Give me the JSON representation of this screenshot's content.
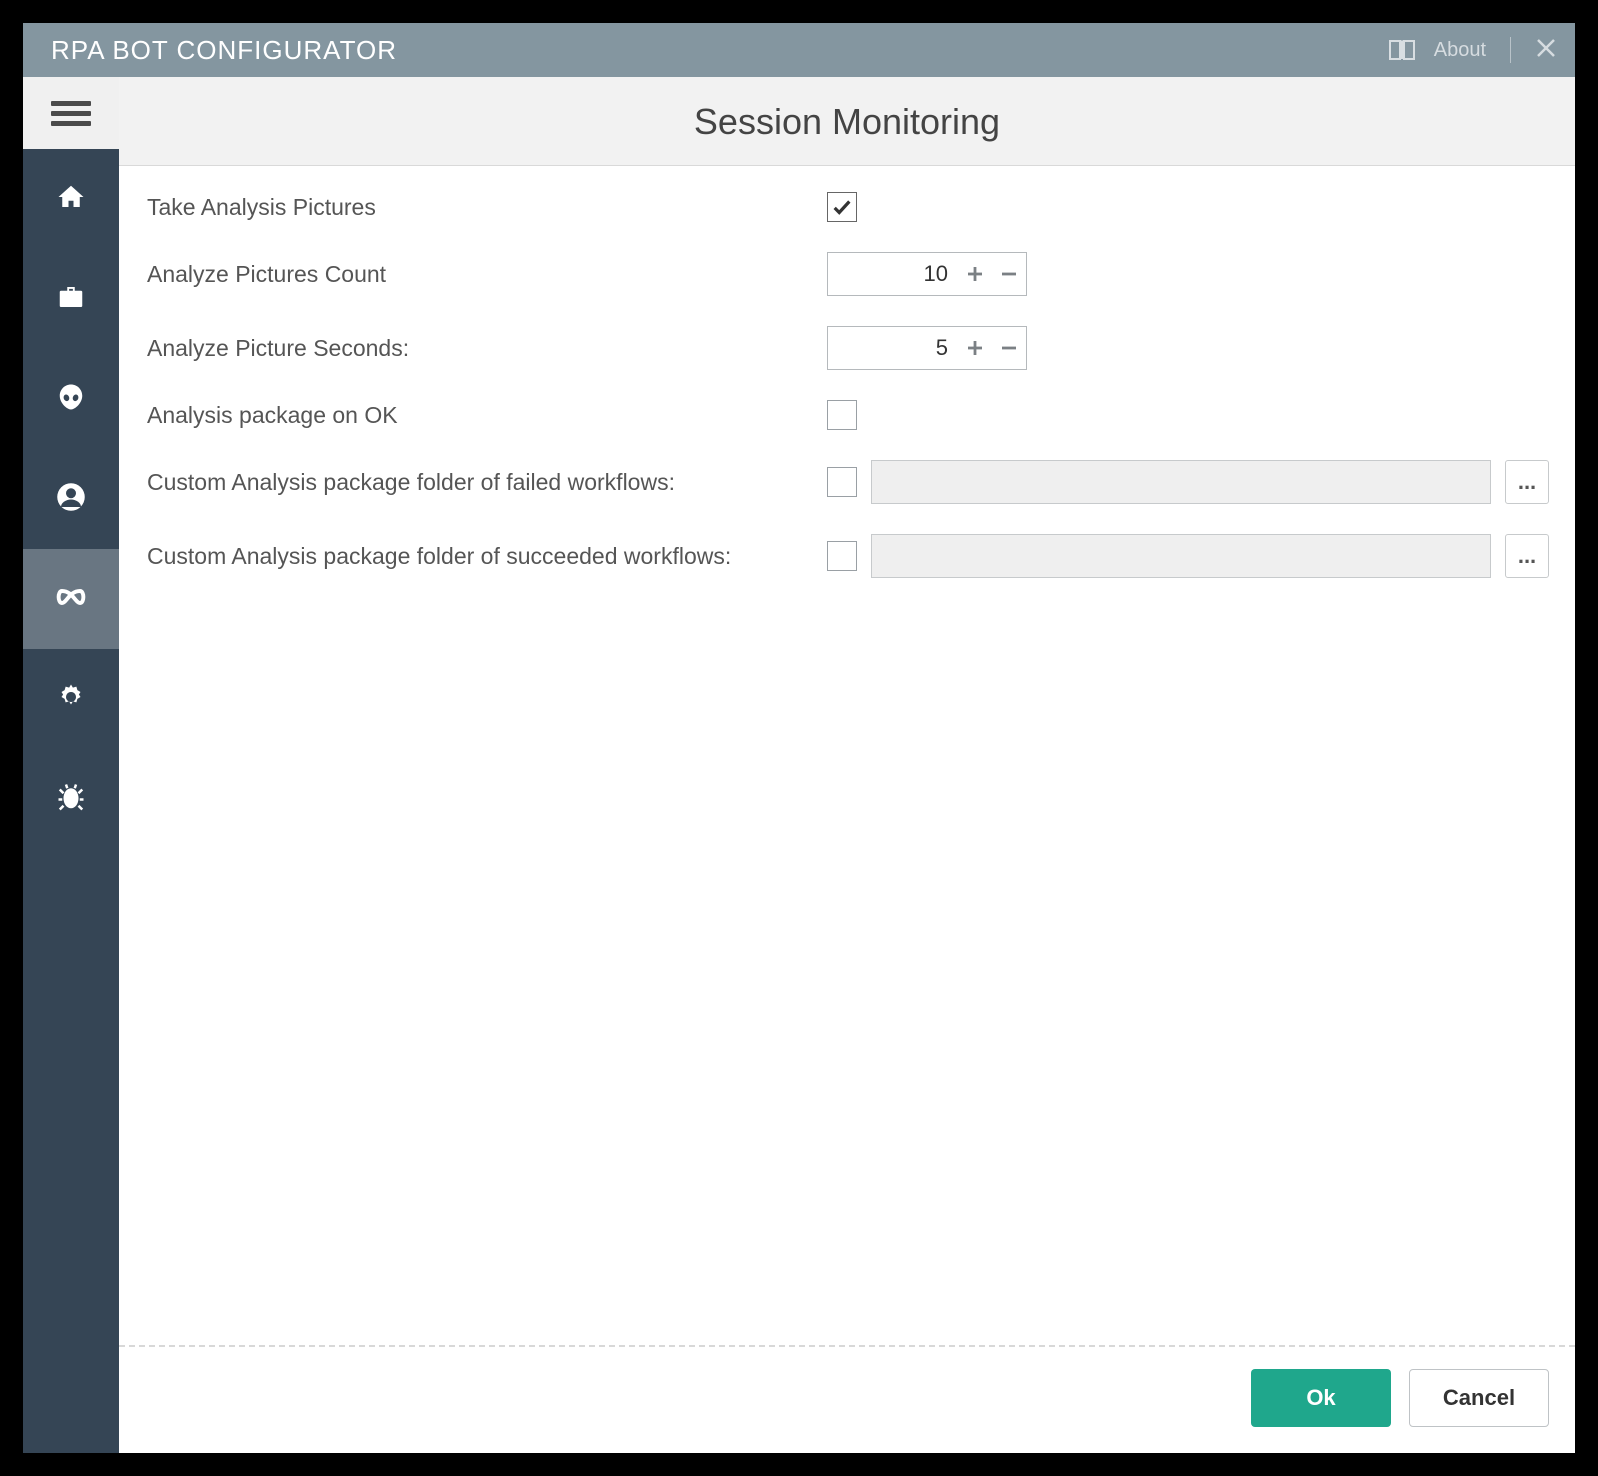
{
  "titlebar": {
    "title": "RPA BOT CONFIGURATOR",
    "about_label": "About"
  },
  "sidebar": {
    "items": [
      {
        "id": "home",
        "icon": "home-icon"
      },
      {
        "id": "briefcase",
        "icon": "briefcase-icon"
      },
      {
        "id": "alien",
        "icon": "alien-icon"
      },
      {
        "id": "person",
        "icon": "person-icon"
      },
      {
        "id": "session-monitoring",
        "icon": "infinity-icon",
        "active": true
      },
      {
        "id": "settings",
        "icon": "gear-icon"
      },
      {
        "id": "debug",
        "icon": "bug-icon"
      }
    ]
  },
  "page": {
    "title": "Session Monitoring"
  },
  "form": {
    "take_analysis_pictures": {
      "label": "Take Analysis Pictures",
      "checked": true
    },
    "analyze_pictures_count": {
      "label": "Analyze Pictures Count",
      "value": "10"
    },
    "analyze_picture_seconds": {
      "label": "Analyze Picture Seconds:",
      "value": "5"
    },
    "analysis_package_on_ok": {
      "label": "Analysis package on OK",
      "checked": false
    },
    "failed_folder": {
      "label": "Custom Analysis package folder of failed workflows:",
      "checked": false,
      "value": "",
      "browse": "..."
    },
    "succeeded_folder": {
      "label": "Custom Analysis package folder of succeeded workflows:",
      "checked": false,
      "value": "",
      "browse": "..."
    }
  },
  "footer": {
    "ok_label": "Ok",
    "cancel_label": "Cancel"
  }
}
